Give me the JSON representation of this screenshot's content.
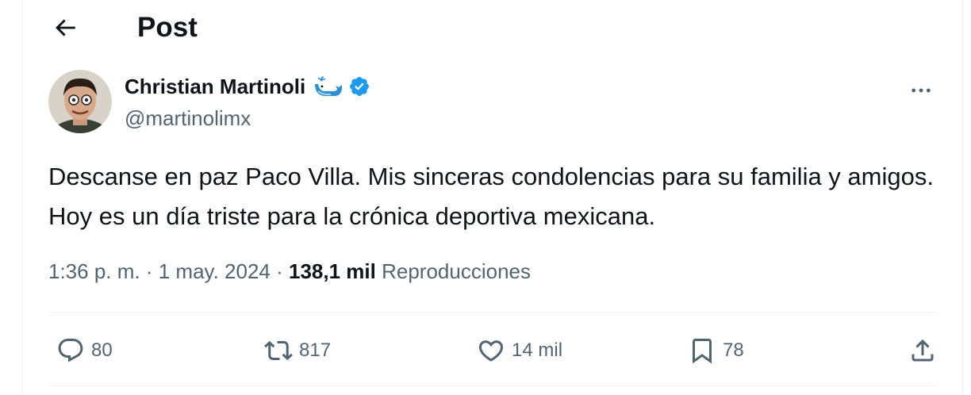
{
  "header": {
    "title": "Post",
    "back_icon": "arrow-left-icon"
  },
  "author": {
    "display_name": "Christian Martinoli",
    "handle": "@martinolimx",
    "emoji_icon": "whale-icon",
    "verified_icon": "verified-badge-icon",
    "verified_color": "#1d9bf0"
  },
  "tweet": {
    "text": "Descanse en paz Paco Villa. Mis sinceras condolencias para su familia y amigos. Hoy es un día triste para la crónica deportiva mexicana."
  },
  "meta": {
    "time": "1:36 p. m.",
    "separator": " · ",
    "date": "1 may. 2024",
    "views_count": "138,1 mil",
    "views_label": "Reproducciones"
  },
  "actions": {
    "replies": "80",
    "reposts": "817",
    "likes": "14 mil",
    "bookmarks": "78"
  },
  "colors": {
    "text": "#0f1419",
    "secondary": "#536471",
    "border": "#eff3f4",
    "accent": "#1d9bf0"
  }
}
